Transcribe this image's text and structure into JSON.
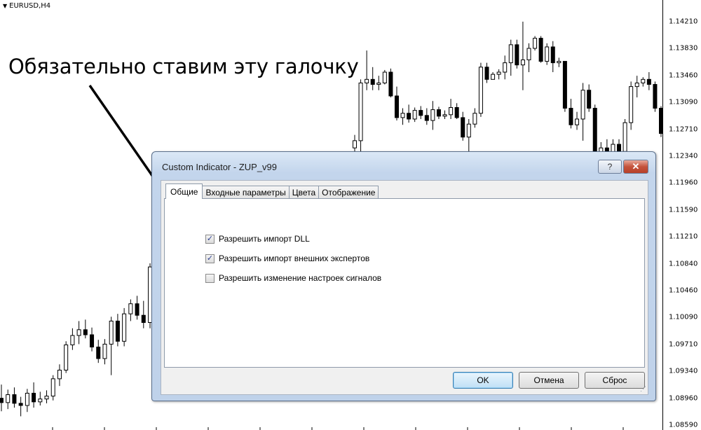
{
  "chart": {
    "symbol": "EURUSD,H4",
    "price_labels": [
      "1.14210",
      "1.13830",
      "1.13460",
      "1.13090",
      "1.12710",
      "1.12340",
      "1.11960",
      "1.11590",
      "1.11210",
      "1.10840",
      "1.10460",
      "1.10090",
      "1.09710",
      "1.09340",
      "1.08960",
      "1.08590"
    ],
    "colors": {
      "up": "#ffffff",
      "down": "#000000",
      "outline": "#000000"
    },
    "candles": [
      [
        1.0903,
        1.0922,
        1.0885,
        1.0897
      ],
      [
        1.0897,
        1.0915,
        1.0888,
        1.0908
      ],
      [
        1.0908,
        1.0918,
        1.089,
        1.0896
      ],
      [
        1.0896,
        1.0905,
        1.0878,
        1.0893
      ],
      [
        1.0893,
        1.0916,
        1.0884,
        1.091
      ],
      [
        1.091,
        1.0925,
        1.089,
        1.0898
      ],
      [
        1.0898,
        1.0912,
        1.0893,
        1.0902
      ],
      [
        1.0902,
        1.0914,
        1.0896,
        1.0906
      ],
      [
        1.0906,
        1.0935,
        1.09,
        1.093
      ],
      [
        1.093,
        1.095,
        1.092,
        1.0942
      ],
      [
        1.0942,
        1.0982,
        1.0938,
        1.0977
      ],
      [
        1.0977,
        1.1,
        1.097,
        1.099
      ],
      [
        1.099,
        1.101,
        1.0978,
        1.0998
      ],
      [
        1.0998,
        1.1012,
        1.0986,
        1.0991
      ],
      [
        1.0991,
        1.1001,
        1.0968,
        1.0974
      ],
      [
        1.0974,
        1.0984,
        1.0952,
        1.0958
      ],
      [
        1.0958,
        1.0985,
        1.095,
        1.0978
      ],
      [
        1.0978,
        1.1016,
        1.0935,
        1.101
      ],
      [
        1.101,
        1.102,
        1.0975,
        1.0982
      ],
      [
        1.0982,
        1.1028,
        1.0975,
        1.102
      ],
      [
        1.102,
        1.104,
        1.101,
        1.1034
      ],
      [
        1.1034,
        1.1045,
        1.1012,
        1.1018
      ],
      [
        1.1018,
        1.1038,
        1.1,
        1.1008
      ],
      [
        1.1008,
        1.109,
        1.1,
        1.1085
      ],
      [
        1.125,
        1.1268,
        1.1236,
        1.126
      ],
      [
        1.126,
        1.1345,
        1.1195,
        1.134
      ],
      [
        1.134,
        1.1385,
        1.133,
        1.1345
      ],
      [
        1.1345,
        1.1362,
        1.133,
        1.1338
      ],
      [
        1.1338,
        1.135,
        1.133,
        1.134
      ],
      [
        1.134,
        1.1358,
        1.1338,
        1.1355
      ],
      [
        1.1355,
        1.136,
        1.132,
        1.1322
      ],
      [
        1.1322,
        1.1335,
        1.1288,
        1.1292
      ],
      [
        1.1292,
        1.1305,
        1.1282,
        1.1298
      ],
      [
        1.1298,
        1.131,
        1.1285,
        1.129
      ],
      [
        1.129,
        1.1306,
        1.1286,
        1.1302
      ],
      [
        1.1302,
        1.1308,
        1.129,
        1.1295
      ],
      [
        1.1295,
        1.1305,
        1.1282,
        1.1288
      ],
      [
        1.1288,
        1.1315,
        1.1275,
        1.1303
      ],
      [
        1.1303,
        1.1307,
        1.129,
        1.1294
      ],
      [
        1.1294,
        1.1302,
        1.129,
        1.1296
      ],
      [
        1.1296,
        1.1318,
        1.129,
        1.1306
      ],
      [
        1.1306,
        1.1312,
        1.129,
        1.1292
      ],
      [
        1.1292,
        1.13,
        1.126,
        1.1265
      ],
      [
        1.1265,
        1.129,
        1.1245,
        1.1283
      ],
      [
        1.1283,
        1.1305,
        1.1278,
        1.1298
      ],
      [
        1.1298,
        1.1368,
        1.1293,
        1.1362
      ],
      [
        1.1362,
        1.1368,
        1.134,
        1.1345
      ],
      [
        1.1345,
        1.1355,
        1.1345,
        1.1352
      ],
      [
        1.1352,
        1.1359,
        1.1345,
        1.1355
      ],
      [
        1.1355,
        1.1378,
        1.1345,
        1.1368
      ],
      [
        1.1368,
        1.14,
        1.135,
        1.1393
      ],
      [
        1.1393,
        1.14,
        1.136,
        1.1365
      ],
      [
        1.1365,
        1.1425,
        1.133,
        1.1372
      ],
      [
        1.1372,
        1.1395,
        1.1355,
        1.1388
      ],
      [
        1.1388,
        1.1405,
        1.1385,
        1.1402
      ],
      [
        1.1402,
        1.1405,
        1.1368,
        1.137
      ],
      [
        1.137,
        1.1395,
        1.1365,
        1.139
      ],
      [
        1.139,
        1.1398,
        1.1355,
        1.1368
      ],
      [
        1.1368,
        1.1375,
        1.1362,
        1.137
      ],
      [
        1.137,
        1.1368,
        1.13,
        1.1305
      ],
      [
        1.1305,
        1.1318,
        1.1277,
        1.1282
      ],
      [
        1.1282,
        1.13,
        1.1275,
        1.129
      ],
      [
        1.129,
        1.134,
        1.126,
        1.133
      ],
      [
        1.133,
        1.1338,
        1.13,
        1.1305
      ],
      [
        1.1305,
        1.131,
        1.123,
        1.124
      ],
      [
        1.124,
        1.1258,
        1.123,
        1.125
      ],
      [
        1.125,
        1.1262,
        1.1235,
        1.1238
      ],
      [
        1.1238,
        1.1262,
        1.1232,
        1.1255
      ],
      [
        1.1255,
        1.1262,
        1.124,
        1.1245
      ],
      [
        1.1245,
        1.129,
        1.124,
        1.1285
      ],
      [
        1.1285,
        1.1342,
        1.1275,
        1.1335
      ],
      [
        1.1335,
        1.135,
        1.132,
        1.134
      ],
      [
        1.134,
        1.1348,
        1.1335,
        1.1345
      ],
      [
        1.1345,
        1.1355,
        1.133,
        1.1338
      ],
      [
        1.1338,
        1.1342,
        1.13,
        1.1305
      ],
      [
        1.1305,
        1.1308,
        1.1265,
        1.127
      ]
    ],
    "candle_range": {
      "x_start": 2,
      "x_end": 943,
      "gap_after_index": 23,
      "gap_x": 506
    },
    "y_range": [
      1.0859,
      1.1455
    ]
  },
  "annotation": {
    "text": "Обязательно ставим эту галочку"
  },
  "dialog": {
    "title": "Custom Indicator - ZUP_v99",
    "help_label": "?",
    "close_label": "✕",
    "tabs": [
      {
        "label": "Общие",
        "active": true
      },
      {
        "label": "Входные параметры",
        "active": false
      },
      {
        "label": "Цвета",
        "active": false
      },
      {
        "label": "Отображение",
        "active": false
      }
    ],
    "checkboxes": [
      {
        "label": "Разрешить импорт DLL",
        "checked": true
      },
      {
        "label": "Разрешить импорт внешних экспертов",
        "checked": true
      },
      {
        "label": "Разрешить изменение настроек сигналов",
        "checked": false
      }
    ],
    "buttons": {
      "ok": "OK",
      "cancel": "Отмена",
      "reset": "Сброс"
    }
  }
}
